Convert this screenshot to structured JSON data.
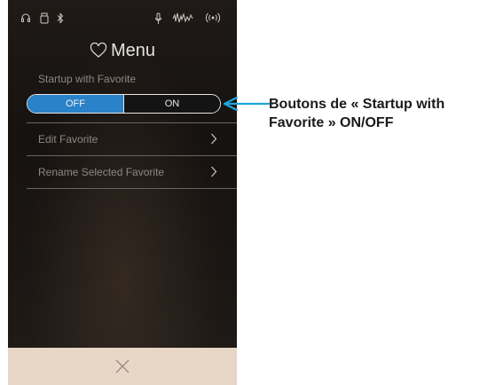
{
  "status_bar": {
    "icons": [
      "headphones-icon",
      "usb-icon",
      "bluetooth-icon",
      "microphone-icon",
      "sound-wave-icon",
      "wireless-icon"
    ]
  },
  "menu": {
    "title": "Menu",
    "title_icon": "heart-icon"
  },
  "startup_section": {
    "label": "Startup with Favorite",
    "off_label": "OFF",
    "on_label": "ON",
    "selected": "OFF",
    "selected_color": "#2a82c9"
  },
  "list": {
    "items": [
      {
        "label": "Edit Favorite",
        "icon": "chevron-right-icon"
      },
      {
        "label": "Rename Selected Favorite",
        "icon": "chevron-right-icon"
      }
    ]
  },
  "bottom_bar": {
    "close_icon": "close-icon",
    "color": "#e8d6c6"
  },
  "callout": {
    "text": "Boutons de « Startup with Favorite » ON/OFF",
    "color": "#1fa6dc"
  }
}
